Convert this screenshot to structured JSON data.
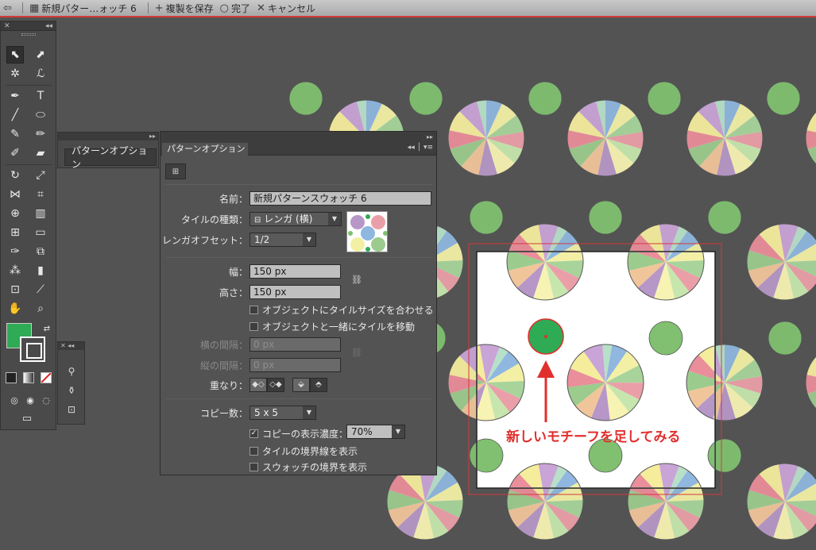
{
  "topbar": {
    "document": "新規パター…ォッチ 6",
    "save_copy": "複製を保存",
    "done": "完了",
    "cancel": "キャンセル",
    "icons": [
      "back-arrow-icon",
      "pattern-doc-icon",
      "plus-icon",
      "circle-icon",
      "x-icon"
    ]
  },
  "colors": {
    "accent_green": "#2faa55",
    "motif_green": "#80c070",
    "boundary_red": "#d33a3a",
    "annotation_red": "#e0302e",
    "canvas_bg": "#535353"
  },
  "collapsed_panel": {
    "label": "パターンオプション"
  },
  "pattern_options": {
    "tab": "パターンオプション",
    "name_label": "名前：",
    "name_value": "新規パターンスウォッチ 6",
    "tile_type_label": "タイルの種類：",
    "tile_type_value": "レンガ (横)",
    "brick_offset_label": "レンガオフセット：",
    "brick_offset_value": "1/2",
    "width_label": "幅：",
    "width_value": "150 px",
    "height_label": "高さ：",
    "height_value": "150 px",
    "fit_tile": "オブジェクトにタイルサイズを合わせる",
    "move_tile": "オブジェクトと一緒にタイルを移動",
    "h_spacing_label": "横の間隔：",
    "h_spacing_value": "0 px",
    "v_spacing_label": "縦の間隔：",
    "v_spacing_value": "0 px",
    "overlap_label": "重なり：",
    "copies_label": "コピー数：",
    "copies_value": "5 x 5",
    "dim_copies_label": "コピーの表示濃度：",
    "dim_copies_value": "70%",
    "dim_copies_checked": true,
    "show_tile_edge": "タイルの境界線を表示",
    "show_swatch_bounds": "スウォッチの境界を表示"
  },
  "annotation": {
    "text": "新しいモチーフを足してみる"
  }
}
